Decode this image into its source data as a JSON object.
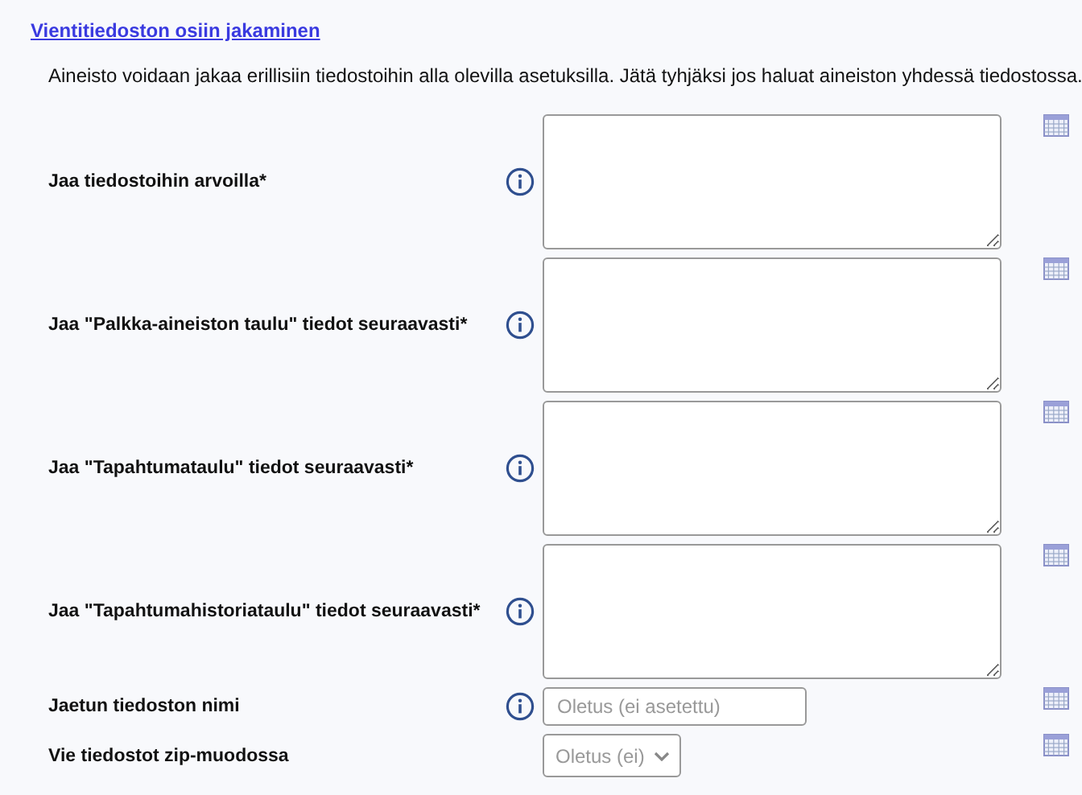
{
  "section": {
    "title": "Vientitiedoston osiin jakaminen",
    "description": "Aineisto voidaan jakaa erillisiin tiedostoihin alla olevilla asetuksilla. Jätä tyhjäksi jos haluat aineiston yhdessä tiedostossa."
  },
  "fields": [
    {
      "kind": "textarea",
      "label": "Jaa tiedostoihin arvoilla*",
      "info": true
    },
    {
      "kind": "textarea",
      "label": "Jaa \"Palkka-aineiston taulu\" tiedot seuraavasti*",
      "info": true
    },
    {
      "kind": "textarea",
      "label": "Jaa \"Tapahtumataulu\" tiedot seuraavasti*",
      "info": true
    },
    {
      "kind": "textarea",
      "label": "Jaa \"Tapahtumahistoriataulu\" tiedot seuraavasti*",
      "info": true
    },
    {
      "kind": "text",
      "label": "Jaetun tiedoston nimi",
      "info": true,
      "placeholder": "Oletus (ei asetettu)"
    },
    {
      "kind": "select",
      "label": "Vie tiedostot zip-muodossa",
      "info": false,
      "value": "Oletus (ei)"
    }
  ]
}
